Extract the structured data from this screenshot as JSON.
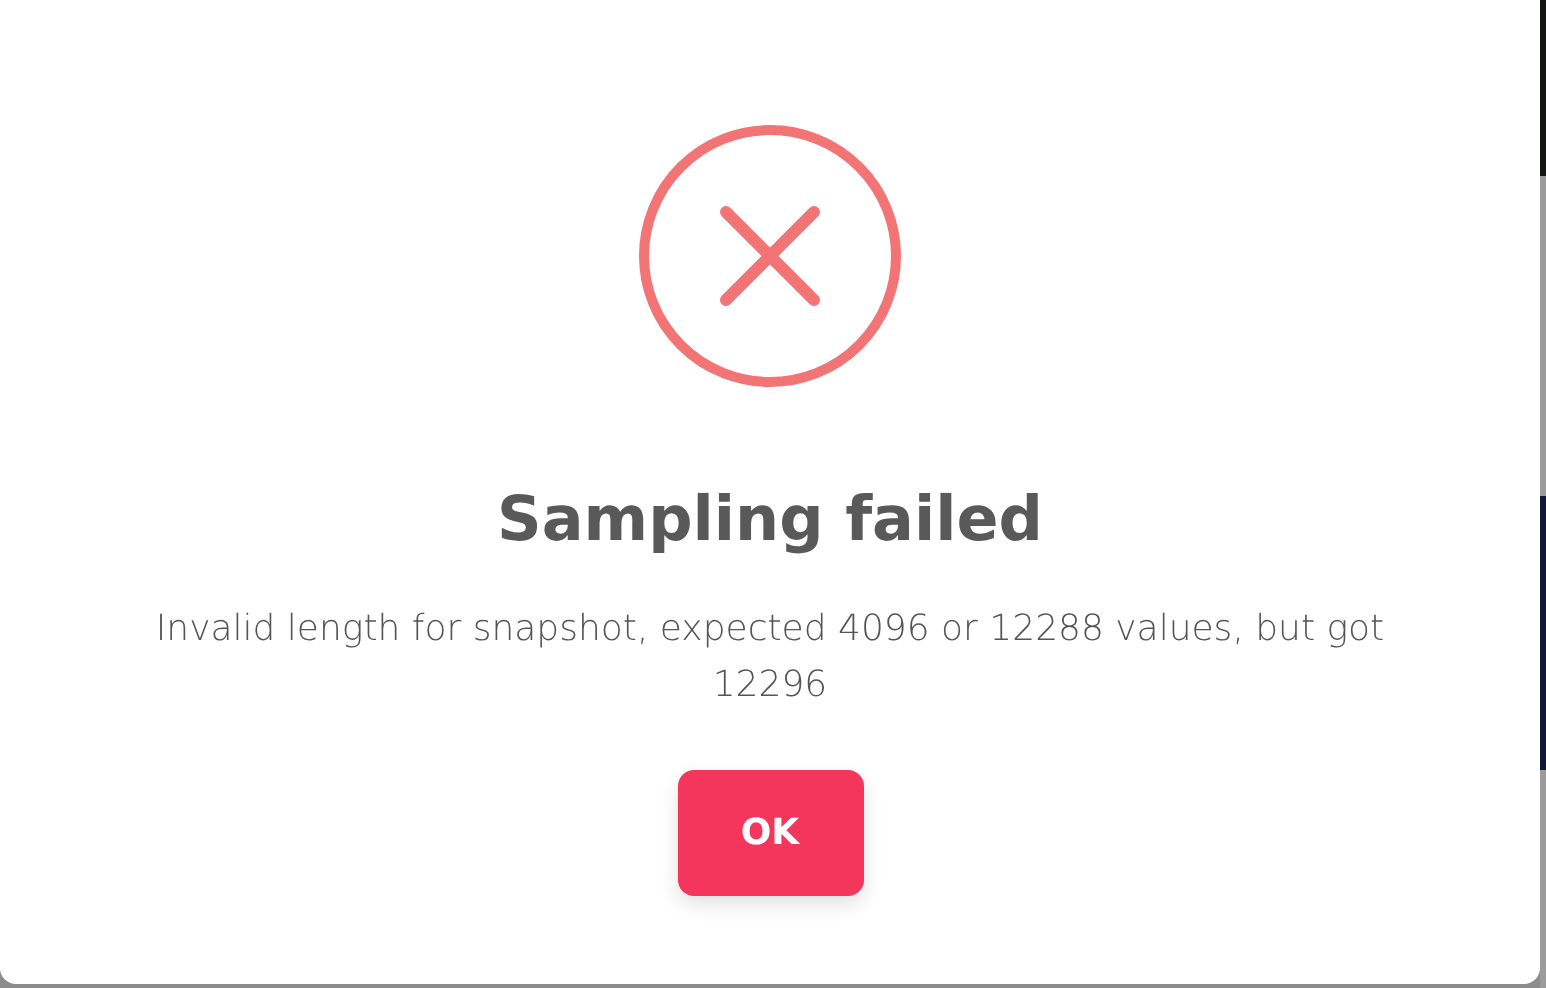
{
  "dialog": {
    "kind": "error",
    "title": "Sampling failed",
    "message": "Invalid length for snapshot, expected 4096 or 12288 values, but got 12296",
    "buttons": [
      {
        "label": "OK"
      }
    ]
  }
}
